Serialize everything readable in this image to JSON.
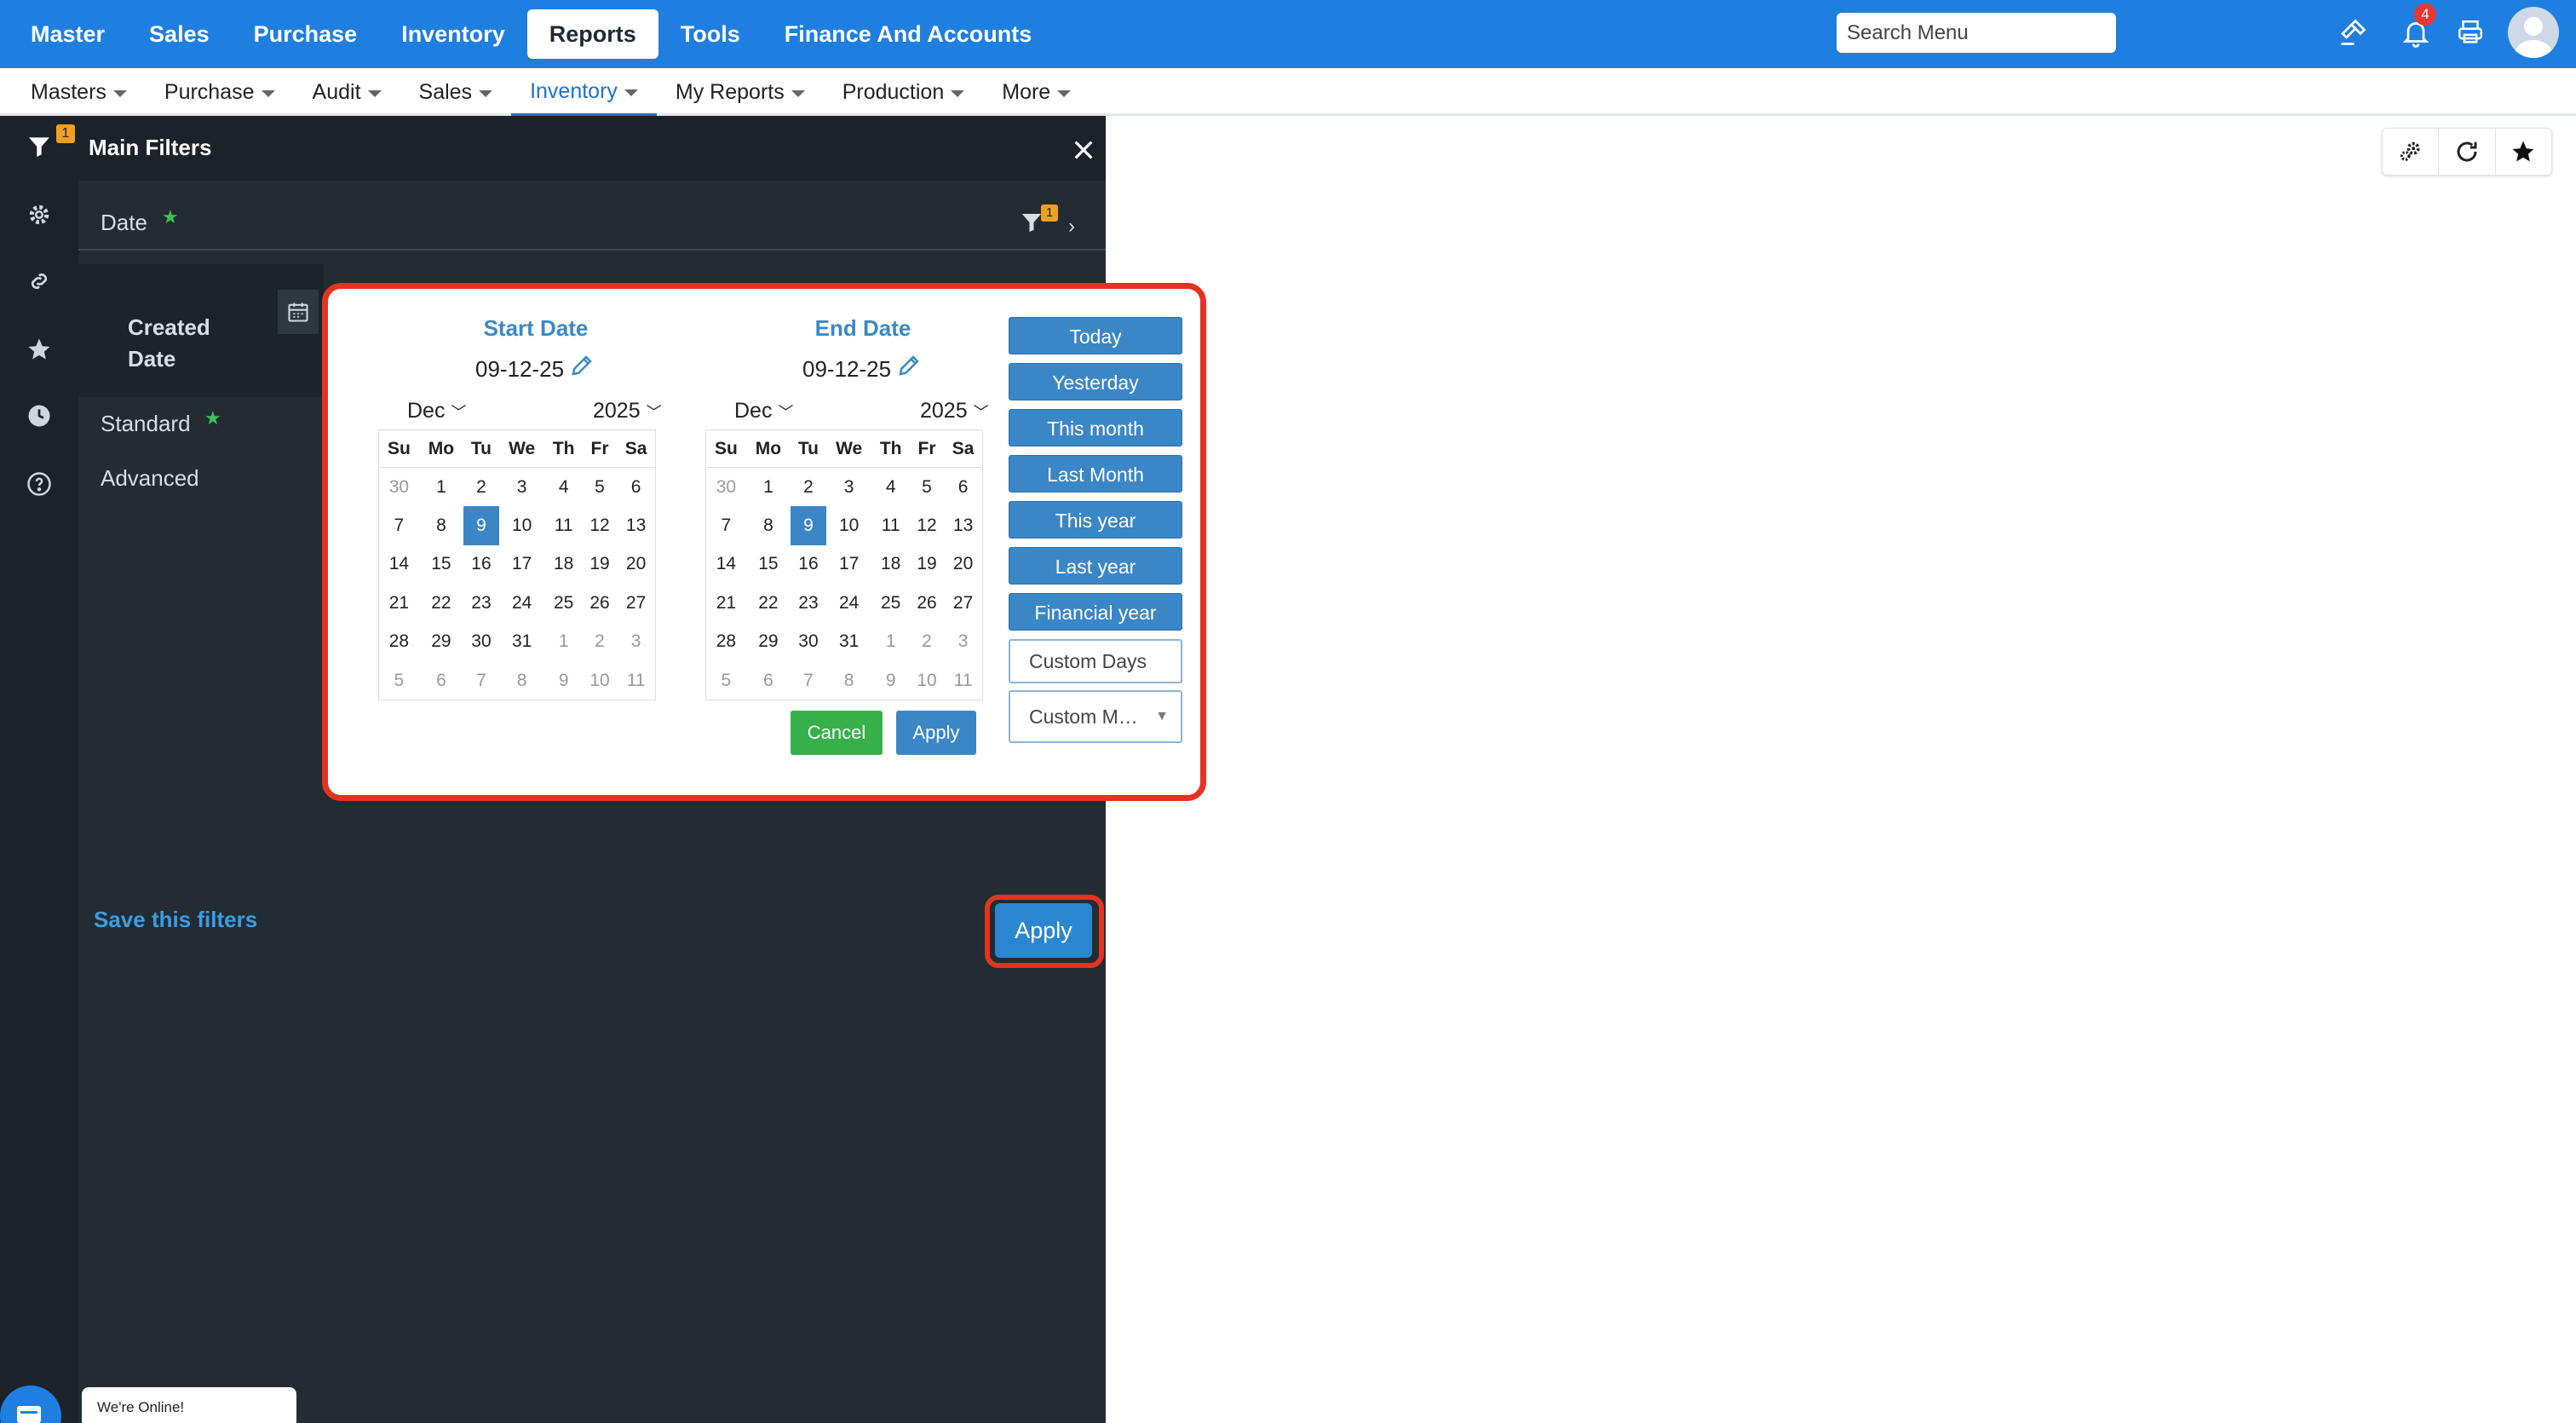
{
  "topnav": {
    "items": [
      "Master",
      "Sales",
      "Purchase",
      "Inventory",
      "Reports",
      "Tools",
      "Finance And Accounts"
    ],
    "active_index": 4,
    "search_placeholder": "Search Menu",
    "notification_count": "4",
    "icons": [
      "gavel-icon",
      "bell-icon",
      "printer-icon",
      "user-avatar"
    ]
  },
  "subnav": {
    "items": [
      "Masters",
      "Purchase",
      "Audit",
      "Sales",
      "Inventory",
      "My Reports",
      "Production",
      "More"
    ],
    "active_index": 4
  },
  "rail": {
    "filter_badge": "1",
    "icons": [
      "filter-icon",
      "gear-icon",
      "link-icon",
      "star-icon",
      "clock-icon",
      "help-icon"
    ]
  },
  "panel": {
    "title": "Main Filters",
    "date_label": "Date",
    "date_filter_badge": "1",
    "created_date_label": "Created Date",
    "standard_label": "Standard",
    "advanced_label": "Advanced",
    "save_filters": "Save this filters",
    "apply": "Apply"
  },
  "datepicker": {
    "start": {
      "heading": "Start Date",
      "value": "09-12-25",
      "month": "Dec",
      "year": "2025"
    },
    "end": {
      "heading": "End Date",
      "value": "09-12-25",
      "month": "Dec",
      "year": "2025"
    },
    "weekdays": [
      "Su",
      "Mo",
      "Tu",
      "We",
      "Th",
      "Fr",
      "Sa"
    ],
    "weeks": [
      [
        "30",
        "1",
        "2",
        "3",
        "4",
        "5",
        "6"
      ],
      [
        "7",
        "8",
        "9",
        "10",
        "11",
        "12",
        "13"
      ],
      [
        "14",
        "15",
        "16",
        "17",
        "18",
        "19",
        "20"
      ],
      [
        "21",
        "22",
        "23",
        "24",
        "25",
        "26",
        "27"
      ],
      [
        "28",
        "29",
        "30",
        "31",
        "1",
        "2",
        "3"
      ],
      [
        "5",
        "6",
        "7",
        "8",
        "9",
        "10",
        "11"
      ]
    ],
    "selected_day": "9",
    "quick_ranges": [
      "Today",
      "Yesterday",
      "This month",
      "Last Month",
      "This year",
      "Last year",
      "Financial year"
    ],
    "custom_days": "Custom Days",
    "custom_months": "Custom M…",
    "cancel": "Cancel",
    "apply": "Apply"
  },
  "toolbar": {
    "icons": [
      "settings-gears-icon",
      "refresh-icon",
      "star-icon"
    ]
  },
  "chat": {
    "status": "We're Online!"
  },
  "colors": {
    "brand_blue": "#1f7fe0",
    "panel_dark": "#232b33",
    "highlight_red": "#e53222",
    "picker_blue": "#3b86c6",
    "cancel_green": "#38b04a"
  }
}
